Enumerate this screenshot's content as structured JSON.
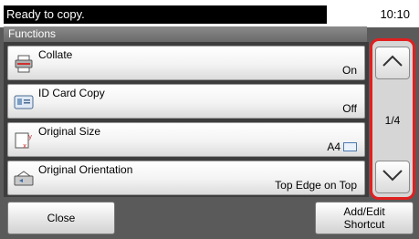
{
  "status": {
    "message": "Ready to copy.",
    "time": "10:10"
  },
  "section": {
    "title": "Functions"
  },
  "functions": [
    {
      "label": "Collate",
      "value": "On",
      "icon": "collate-icon"
    },
    {
      "label": "ID Card Copy",
      "value": "Off",
      "icon": "id-card-icon"
    },
    {
      "label": "Original Size",
      "value": "A4",
      "icon": "original-size-icon"
    },
    {
      "label": "Original Orientation",
      "value": "Top Edge on Top",
      "icon": "original-orientation-icon"
    }
  ],
  "scroll": {
    "page": "1/4",
    "up_icon": "chevron-up-icon",
    "down_icon": "chevron-down-icon"
  },
  "footer": {
    "close_label": "Close",
    "shortcut_line1": "Add/Edit",
    "shortcut_line2": "Shortcut"
  },
  "colors": {
    "highlight": "#e02020",
    "status_bg": "#000000",
    "panel_bg": "#5a5a5a"
  }
}
